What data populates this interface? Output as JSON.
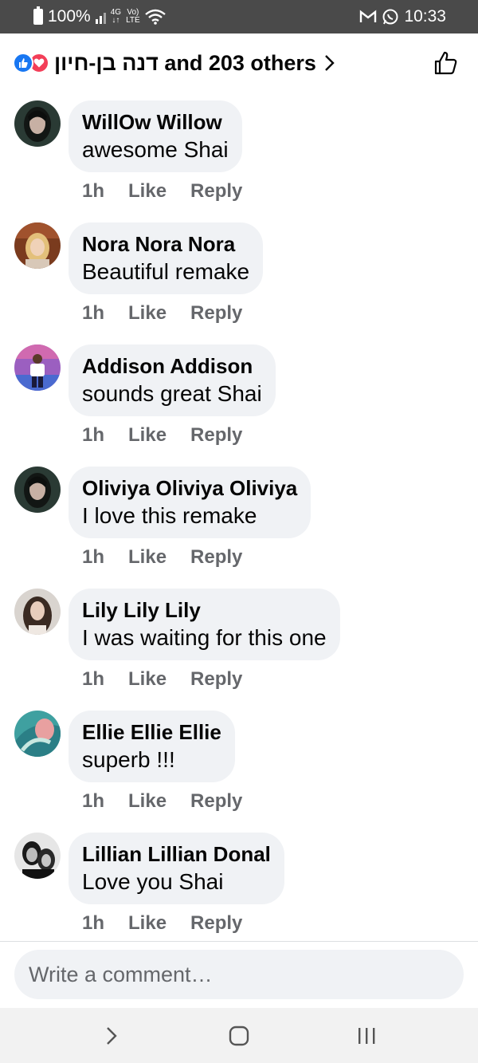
{
  "status_bar": {
    "battery": "100%",
    "network": "4G",
    "volte": "LTE",
    "time": "10:33"
  },
  "reactions": {
    "summary": "דנה בן-חיון and 203 others",
    "like_color": "#1877f2",
    "love_color": "#f33e58"
  },
  "comments": [
    {
      "author": "WillOw Willow",
      "text": "awesome Shai",
      "time": "1h",
      "like": "Like",
      "reply": "Reply",
      "avatar": "avatar-dark-hair-woman"
    },
    {
      "author": "Nora Nora Nora",
      "text": "Beautiful remake",
      "time": "1h",
      "like": "Like",
      "reply": "Reply",
      "avatar": "avatar-blonde-woman"
    },
    {
      "author": "Addison Addison",
      "text": "sounds great Shai",
      "time": "1h",
      "like": "Like",
      "reply": "Reply",
      "avatar": "avatar-person-standing"
    },
    {
      "author": "Oliviya Oliviya Oliviya",
      "text": "I love this remake",
      "time": "1h",
      "like": "Like",
      "reply": "Reply",
      "avatar": "avatar-dark-hair-woman"
    },
    {
      "author": "Lily Lily Lily",
      "text": "I was waiting for this one",
      "time": "1h",
      "like": "Like",
      "reply": "Reply",
      "avatar": "avatar-long-hair-woman"
    },
    {
      "author": "Ellie Ellie Ellie",
      "text": "superb !!!",
      "time": "1h",
      "like": "Like",
      "reply": "Reply",
      "avatar": "avatar-teal-abstract"
    },
    {
      "author": "Lillian Lillian Donal",
      "text": "Love you Shai",
      "time": "1h",
      "like": "Like",
      "reply": "Reply",
      "avatar": "avatar-bw-couple"
    }
  ],
  "composer": {
    "placeholder": "Write a comment…"
  },
  "colors": {
    "bubble": "#f0f2f5",
    "meta_text": "#65676b"
  }
}
